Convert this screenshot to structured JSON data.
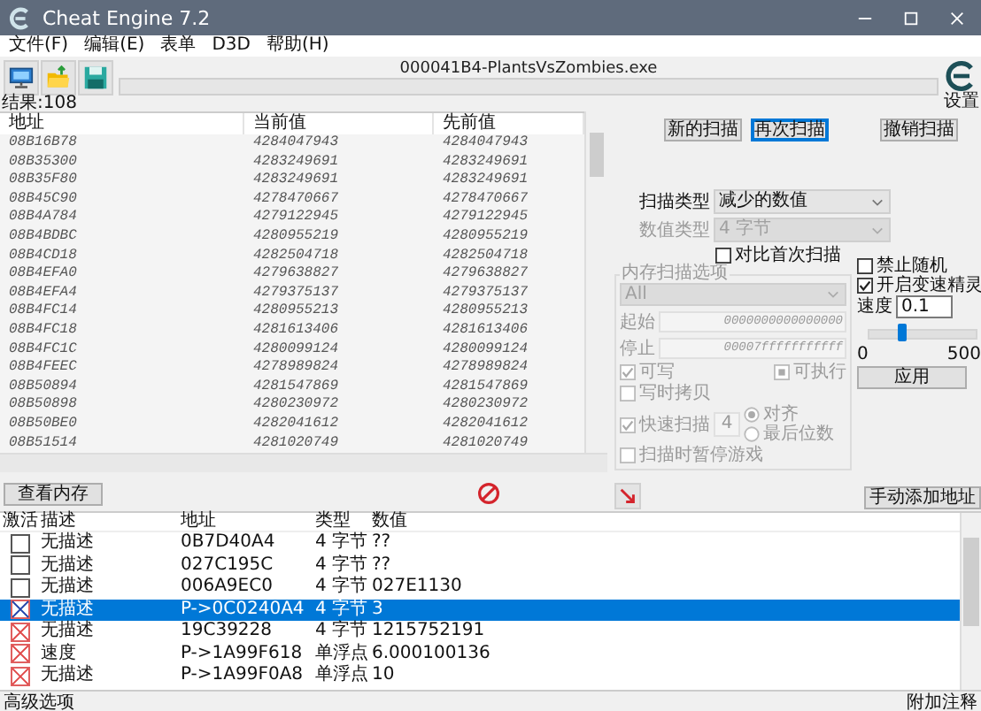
{
  "window": {
    "title": "Cheat Engine 7.2"
  },
  "menu": [
    "文件(F)",
    "编辑(E)",
    "表单",
    "D3D",
    "帮助(H)"
  ],
  "process": "000041B4-PlantsVsZombies.exe",
  "progress": {
    "level": 0
  },
  "settings_label": "设置",
  "results": "结果:108",
  "scan_list": {
    "columns": [
      "地址",
      "当前值",
      "先前值"
    ],
    "rows": [
      [
        "08B16B78",
        "4284047943",
        "4284047943"
      ],
      [
        "08B35300",
        "4283249691",
        "4283249691"
      ],
      [
        "08B35F80",
        "4283249691",
        "4283249691"
      ],
      [
        "08B45C90",
        "4278470667",
        "4278470667"
      ],
      [
        "08B4A784",
        "4279122945",
        "4279122945"
      ],
      [
        "08B4BDBC",
        "4280955219",
        "4280955219"
      ],
      [
        "08B4CD18",
        "4282504718",
        "4282504718"
      ],
      [
        "08B4EFA0",
        "4279638827",
        "4279638827"
      ],
      [
        "08B4EFA4",
        "4279375137",
        "4279375137"
      ],
      [
        "08B4FC14",
        "4280955213",
        "4280955213"
      ],
      [
        "08B4FC18",
        "4281613406",
        "4281613406"
      ],
      [
        "08B4FC1C",
        "4280099124",
        "4280099124"
      ],
      [
        "08B4FEEC",
        "4278989824",
        "4278989824"
      ],
      [
        "08B50894",
        "4281547869",
        "4281547869"
      ],
      [
        "08B50898",
        "4280230972",
        "4280230972"
      ],
      [
        "08B50BE0",
        "4282041612",
        "4282041612"
      ],
      [
        "08B51514",
        "4281020749",
        "4281020749"
      ]
    ]
  },
  "scan_buttons": [
    {
      "label": "新的扫描",
      "focused": false
    },
    {
      "label": "再次扫描",
      "focused": true
    },
    {
      "label": "撤销扫描",
      "focused": false
    }
  ],
  "scan_type": {
    "label": "扫描类型",
    "value": "减少的数值",
    "disabled": false
  },
  "value_type": {
    "label": "数值类型",
    "value": "4 字节",
    "disabled": true
  },
  "compare_first": {
    "label": "对比首次扫描",
    "checked": false
  },
  "memory_options": {
    "title": "内存扫描选项",
    "disabled": true,
    "region": "All",
    "start_label": "起始",
    "start": "0000000000000000",
    "stop_label": "停止",
    "stop": "00007fffffffffff",
    "writable": {
      "label": "可写",
      "checked": true
    },
    "executable": {
      "label": "可执行",
      "indeterminate": true
    },
    "copy_on_write": {
      "label": "写时拷贝",
      "checked": false
    },
    "fast_scan": {
      "label": "快速扫描",
      "checked": true,
      "value": "4"
    },
    "alignment": [
      {
        "label": "对齐",
        "selected": true
      },
      {
        "label": "最后位数",
        "selected": false
      }
    ],
    "pause_game": {
      "label": "扫描时暂停游戏",
      "checked": false
    }
  },
  "speedhack": {
    "no_random": {
      "label": "禁止随机",
      "checked": false
    },
    "enable": {
      "label": "开启变速精灵",
      "checked": true
    },
    "speed_label": "速度",
    "speed": "0.1",
    "level": 0.3,
    "min": "0",
    "max": "500",
    "apply": "应用"
  },
  "view_memory": "查看内存",
  "add_address": "手动添加地址",
  "cheat_table": {
    "columns": [
      "激活",
      "描述",
      "地址",
      "类型",
      "数值"
    ],
    "rows": [
      {
        "active": false,
        "selected": false,
        "description": "无描述",
        "address": "0B7D40A4",
        "type": "4 字节",
        "value": "??"
      },
      {
        "active": false,
        "selected": false,
        "description": "无描述",
        "address": "027C195C",
        "type": "4 字节",
        "value": "??"
      },
      {
        "active": false,
        "selected": false,
        "description": "无描述",
        "address": "006A9EC0",
        "type": "4 字节",
        "value": "027E1130"
      },
      {
        "active": true,
        "selected": true,
        "description": "无描述",
        "address": "P->0C0240A4",
        "type": "4 字节",
        "value": "3"
      },
      {
        "active": true,
        "selected": false,
        "description": "无描述",
        "address": "19C39228",
        "type": "4 字节",
        "value": "1215752191"
      },
      {
        "active": true,
        "selected": false,
        "description": "速度",
        "address": "P->1A99F618",
        "type": "单浮点",
        "value": "6.000100136"
      },
      {
        "active": true,
        "selected": false,
        "description": "无描述",
        "address": "P->1A99F0A8",
        "type": "单浮点",
        "value": "10"
      }
    ]
  },
  "status_bar": {
    "left": "高级选项",
    "right": "附加注释"
  }
}
